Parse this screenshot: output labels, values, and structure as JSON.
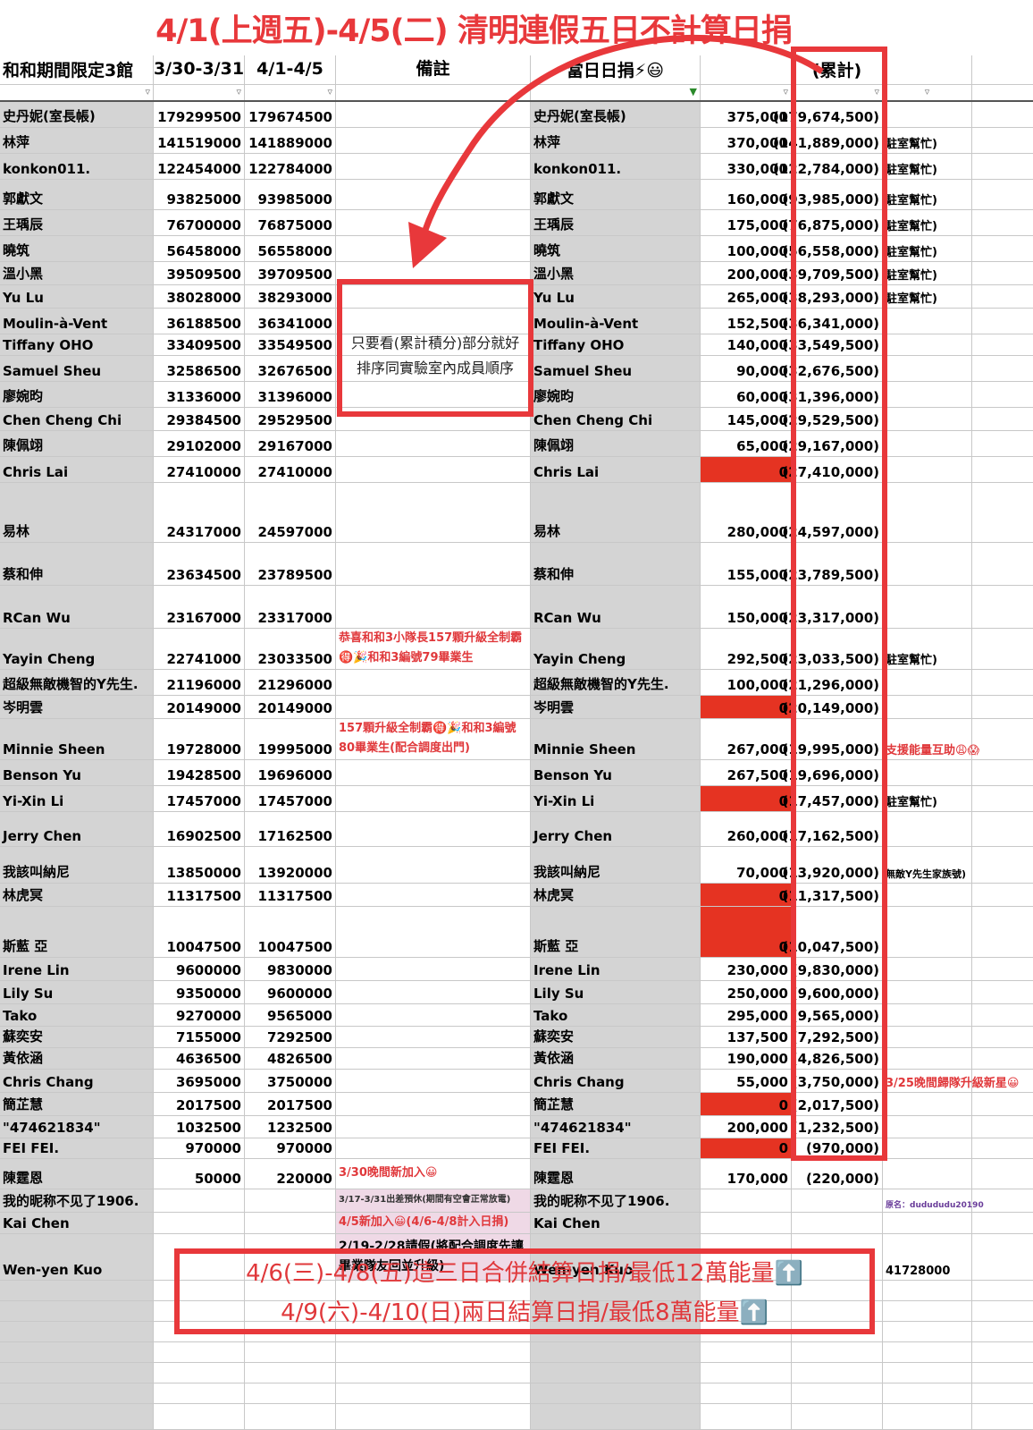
{
  "title": "4/1(上週五)-4/5(二) 清明連假五日不計算日捐",
  "headers": [
    "和和期間限定3館",
    "3/30-3/31",
    "4/1-4/5",
    "備註",
    "當日日捐⚡😃",
    "",
    "(累計)",
    "",
    ""
  ],
  "rows": [
    {
      "name": "史丹妮(室長帳)",
      "a": "179299500",
      "b": "179674500",
      "note": "",
      "name2": "史丹妮(室長帳)",
      "daily": "375,000",
      "total": "(179,674,500)",
      "extra": "",
      "h": 28
    },
    {
      "name": "林萍",
      "a": "141519000",
      "b": "141889000",
      "note": "",
      "name2": "林萍",
      "daily": "370,000",
      "total": "(141,889,000)",
      "extra": "駐室幫忙)",
      "h": 28
    },
    {
      "name": "konkon011.",
      "a": "122454000",
      "b": "122784000",
      "note": "",
      "name2": "konkon011.",
      "daily": "330,000",
      "total": "(122,784,000)",
      "extra": "駐室幫忙)",
      "h": 28
    },
    {
      "name": "郭獻文",
      "a": "93825000",
      "b": "93985000",
      "note": "",
      "name2": "郭獻文",
      "daily": "160,000",
      "total": "(93,985,000)",
      "extra": "駐室幫忙)",
      "h": 33
    },
    {
      "name": "王瑀辰",
      "a": "76700000",
      "b": "76875000",
      "note": "",
      "name2": "王瑀辰",
      "daily": "175,000",
      "total": "(76,875,000)",
      "extra": "駐室幫忙)",
      "h": 28
    },
    {
      "name": "曉筑",
      "a": "56458000",
      "b": "56558000",
      "note": "",
      "name2": "曉筑",
      "daily": "100,000",
      "total": "(56,558,000)",
      "extra": "駐室幫忙)",
      "h": 28
    },
    {
      "name": "溫小黑",
      "a": "39509500",
      "b": "39709500",
      "note": "",
      "name2": "溫小黑",
      "daily": "200,000",
      "total": "(39,709,500)",
      "extra": "駐室幫忙)",
      "h": 25
    },
    {
      "name": "Yu Lu",
      "a": "38028000",
      "b": "38293000",
      "note": "",
      "name2": "Yu Lu",
      "daily": "265,000",
      "total": "(38,293,000)",
      "extra": "駐室幫忙)",
      "h": 25
    },
    {
      "name": "Moulin-à-Vent",
      "a": "36188500",
      "b": "36341000",
      "note": "",
      "name2": "Moulin-à-Vent",
      "daily": "152,500",
      "total": "(36,341,000)",
      "extra": "",
      "h": 28
    },
    {
      "name": "Tiffany OHO",
      "a": "33409500",
      "b": "33549500",
      "note": "",
      "name2": "Tiffany OHO",
      "daily": "140,000",
      "total": "(33,549,500)",
      "extra": "",
      "h": 23
    },
    {
      "name": "Samuel Sheu",
      "a": "32586500",
      "b": "32676500",
      "note": "",
      "name2": "Samuel Sheu",
      "daily": "90,000",
      "total": "(32,676,500)",
      "extra": "",
      "h": 28
    },
    {
      "name": "廖婉昀",
      "a": "31336000",
      "b": "31396000",
      "note": "",
      "name2": "廖婉昀",
      "daily": "60,000",
      "total": "(31,396,000)",
      "extra": "",
      "h": 28
    },
    {
      "name": "Chen Cheng Chi",
      "a": "29384500",
      "b": "29529500",
      "note": "",
      "name2": "Chen Cheng Chi",
      "daily": "145,000",
      "total": "(29,529,500)",
      "extra": "",
      "h": 25
    },
    {
      "name": "陳佩翊",
      "a": "29102000",
      "b": "29167000",
      "note": "",
      "name2": "陳佩翊",
      "daily": "65,000",
      "total": "(29,167,000)",
      "extra": "",
      "h": 28
    },
    {
      "name": "Chris Lai",
      "a": "27410000",
      "b": "27410000",
      "note": "",
      "name2": "Chris Lai",
      "daily": "0",
      "total": "(27,410,000)",
      "extra": "",
      "h": 28
    },
    {
      "name": "易林",
      "a": "24317000",
      "b": "24597000",
      "note": "",
      "name2": "易林",
      "daily": "280,000",
      "total": "(24,597,000)",
      "extra": "",
      "h": 66
    },
    {
      "name": "蔡和伸",
      "a": "23634500",
      "b": "23789500",
      "note": "",
      "name2": "蔡和伸",
      "daily": "155,000",
      "total": "(23,789,500)",
      "extra": "",
      "h": 47
    },
    {
      "name": "RCan Wu",
      "a": "23167000",
      "b": "23317000",
      "note": "",
      "name2": "RCan Wu",
      "daily": "150,000",
      "total": "(23,317,000)",
      "extra": "",
      "h": 47
    },
    {
      "name": "Yayin Cheng",
      "a": "22741000",
      "b": "23033500",
      "note": "恭喜和和3小隊長157顆升級全制霸🉐🎉和和3編號79畢業生",
      "name2": "Yayin Cheng",
      "daily": "292,500",
      "total": "(23,033,500)",
      "extra": "駐室幫忙)",
      "h": 45
    },
    {
      "name": "超級無敵機智的Y先生.",
      "a": "21196000",
      "b": "21296000",
      "note": "",
      "name2": "超級無敵機智的Y先生.",
      "daily": "100,000",
      "total": "(21,296,000)",
      "extra": "",
      "h": 28
    },
    {
      "name": "岑明雲",
      "a": "20149000",
      "b": "20149000",
      "note": "",
      "name2": "岑明雲",
      "daily": "0",
      "total": "(20,149,000)",
      "extra": "",
      "h": 25
    },
    {
      "name": "Minnie Sheen",
      "a": "19728000",
      "b": "19995000",
      "note": "157顆升級全制霸🉐🎉和和3編號80畢業生(配合調度出門)",
      "name2": "Minnie Sheen",
      "daily": "267,000",
      "total": "(19,995,000)",
      "extra": "支援能量互助😩😱",
      "h": 45
    },
    {
      "name": "Benson Yu",
      "a": "19428500",
      "b": "19696000",
      "note": "",
      "name2": "Benson Yu",
      "daily": "267,500",
      "total": "(19,696,000)",
      "extra": "",
      "h": 28
    },
    {
      "name": "Yi-Xin Li",
      "a": "17457000",
      "b": "17457000",
      "note": "",
      "name2": "Yi-Xin Li",
      "daily": "0",
      "total": "(17,457,000)",
      "extra": "駐室幫忙)",
      "h": 28
    },
    {
      "name": "Jerry Chen",
      "a": "16902500",
      "b": "17162500",
      "note": "",
      "name2": "Jerry Chen",
      "daily": "260,000",
      "total": "(17,162,500)",
      "extra": "",
      "h": 38
    },
    {
      "name": "我該叫納尼",
      "a": "13850000",
      "b": "13920000",
      "note": "",
      "name2": "我該叫納尼",
      "daily": "70,000",
      "total": "(13,920,000)",
      "extra": "無敵Y先生家族號)",
      "h": 40
    },
    {
      "name": "林虎冥",
      "a": "11317500",
      "b": "11317500",
      "note": "",
      "name2": "林虎冥",
      "daily": "0",
      "total": "(11,317,500)",
      "extra": "",
      "h": 25
    },
    {
      "name": "斯藍 亞",
      "a": "10047500",
      "b": "10047500",
      "note": "",
      "name2": "斯藍 亞",
      "daily": "0",
      "total": "(10,047,500)",
      "extra": "",
      "h": 56
    },
    {
      "name": "Irene Lin",
      "a": "9600000",
      "b": "9830000",
      "note": "",
      "name2": "Irene Lin",
      "daily": "230,000",
      "total": "(9,830,000)",
      "extra": "",
      "h": 25
    },
    {
      "name": "Lily Su",
      "a": "9350000",
      "b": "9600000",
      "note": "",
      "name2": "Lily Su",
      "daily": "250,000",
      "total": "(9,600,000)",
      "extra": "",
      "h": 25
    },
    {
      "name": "Tako",
      "a": "9270000",
      "b": "9565000",
      "note": "",
      "name2": "Tako",
      "daily": "295,000",
      "total": "(9,565,000)",
      "extra": "",
      "h": 24
    },
    {
      "name": "蘇奕安",
      "a": "7155000",
      "b": "7292500",
      "note": "",
      "name2": "蘇奕安",
      "daily": "137,500",
      "total": "(7,292,500)",
      "extra": "",
      "h": 23
    },
    {
      "name": "黃依涵",
      "a": "4636500",
      "b": "4826500",
      "note": "",
      "name2": "黃依涵",
      "daily": "190,000",
      "total": "(4,826,500)",
      "extra": "",
      "h": 23
    },
    {
      "name": "Chris Chang",
      "a": "3695000",
      "b": "3750000",
      "note": "",
      "name2": "Chris Chang",
      "daily": "55,000",
      "total": "(3,750,000)",
      "extra": "3/25晚間歸隊升級新星😀",
      "h": 25
    },
    {
      "name": "簡芷慧",
      "a": "2017500",
      "b": "2017500",
      "note": "",
      "name2": "簡芷慧",
      "daily": "0",
      "total": "(2,017,500)",
      "extra": "",
      "h": 25
    },
    {
      "name": "\"474621834\"",
      "a": "1032500",
      "b": "1232500",
      "note": "",
      "name2": "\"474621834\"",
      "daily": "200,000",
      "total": "(1,232,500)",
      "extra": "",
      "h": 24
    },
    {
      "name": "FEI FEI.",
      "a": "970000",
      "b": "970000",
      "note": "",
      "name2": "FEI FEI.",
      "daily": "0",
      "total": "(970,000)",
      "extra": "",
      "h": 22
    },
    {
      "name": "陳霆恩",
      "a": "50000",
      "b": "220000",
      "note": "3/30晚間新加入😀",
      "name2": "陳霆恩",
      "daily": "170,000",
      "total": "(220,000)",
      "extra": "",
      "h": 33
    },
    {
      "name": "我的昵称不见了1906.",
      "a": "",
      "b": "",
      "note": "3/17-3/31出差預休(期間有空會正常放電)",
      "name2": "我的昵称不见了1906.",
      "daily": "",
      "total": "",
      "extra": "原名：dudududu20190",
      "h": 25
    },
    {
      "name": "Kai Chen",
      "a": "",
      "b": "",
      "note": "4/5新加入😀(4/6-4/8計入日捐)",
      "name2": "Kai Chen",
      "daily": "",
      "total": "",
      "extra": "",
      "h": 23
    },
    {
      "name": "Wen-yen Kuo",
      "a": "",
      "b": "",
      "note": "2/19-2/28請假(將配合調度先讓畢業隊友回並升級)",
      "name2": "Wen-yen Kuo",
      "daily": "",
      "total": "",
      "extra": "41728000",
      "h": 51
    }
  ],
  "box_note": [
    "只要看(累計積分)部分就好",
    "排序同實驗室內成員順序"
  ],
  "bottom_note": [
    "4/6(三)-4/8(五)這三日合併結算日捐/最低12萬能量⬆️",
    "4/9(六)-4/10(日)兩日結算日捐/最低8萬能量⬆️"
  ],
  "colors": {
    "accent": "#e8383b",
    "zero_cell": "#e53322",
    "name_col": "#d4d4d4"
  }
}
